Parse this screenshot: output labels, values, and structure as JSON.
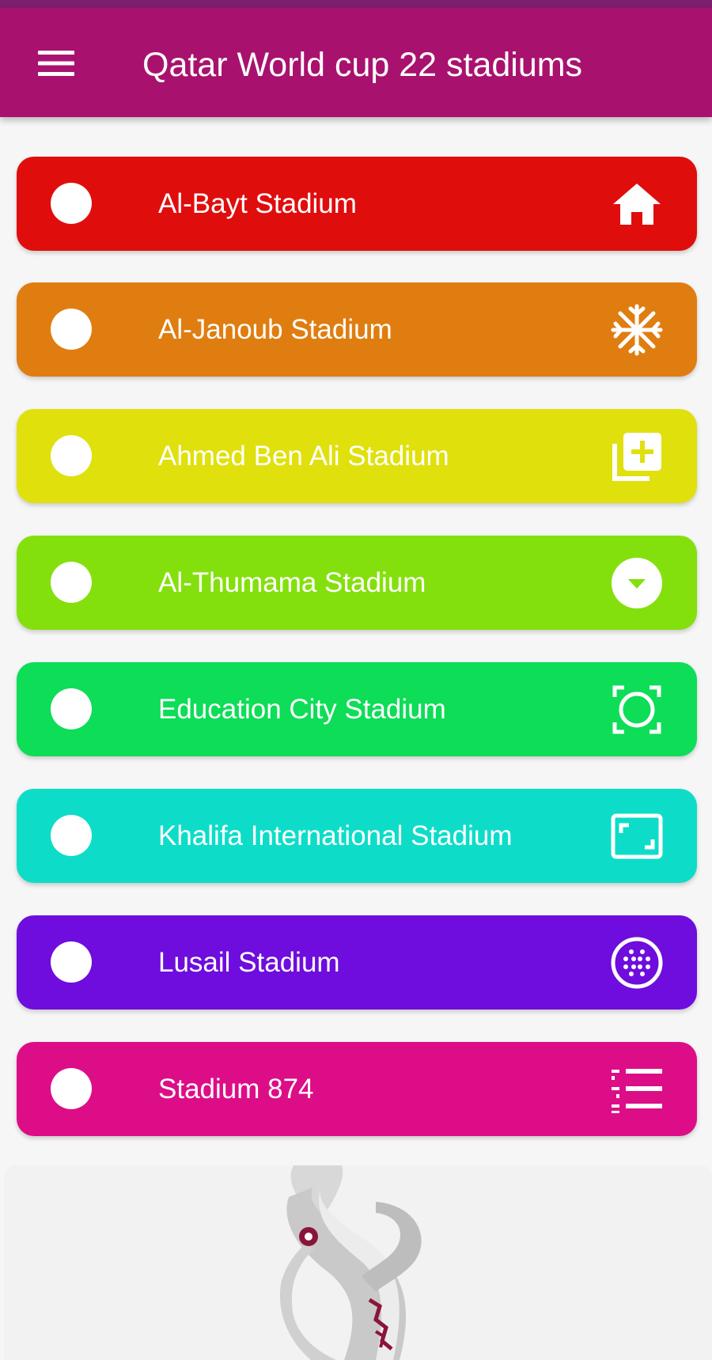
{
  "app": {
    "title": "Qatar World cup 22 stadiums"
  },
  "colors": {
    "status_bar": "#7d1f6e",
    "app_bar": "#a8126e",
    "background": "#f6f6f6"
  },
  "stadiums": [
    {
      "label": "Al-Bayt Stadium",
      "color": "#e00d0d",
      "icon": "home-icon"
    },
    {
      "label": "Al-Janoub Stadium",
      "color": "#e07d10",
      "icon": "snowflake-icon"
    },
    {
      "label": "Ahmed Ben Ali Stadium",
      "color": "#e0e00d",
      "icon": "library-add-icon"
    },
    {
      "label": "Al-Thumama Stadium",
      "color": "#84e00d",
      "icon": "arrow-drop-down-circle-icon"
    },
    {
      "label": "Education City Stadium",
      "color": "#0ddd57",
      "icon": "center-focus-icon"
    },
    {
      "label": "Khalifa International Stadium",
      "color": "#0dddc8",
      "icon": "aspect-ratio-icon"
    },
    {
      "label": "Lusail Stadium",
      "color": "#6e0ddd",
      "icon": "grid-circle-icon"
    },
    {
      "label": "Stadium 874",
      "color": "#dd0d87",
      "icon": "numbered-list-icon"
    }
  ],
  "banner": {
    "icon": "world-cup-emblem-image"
  }
}
